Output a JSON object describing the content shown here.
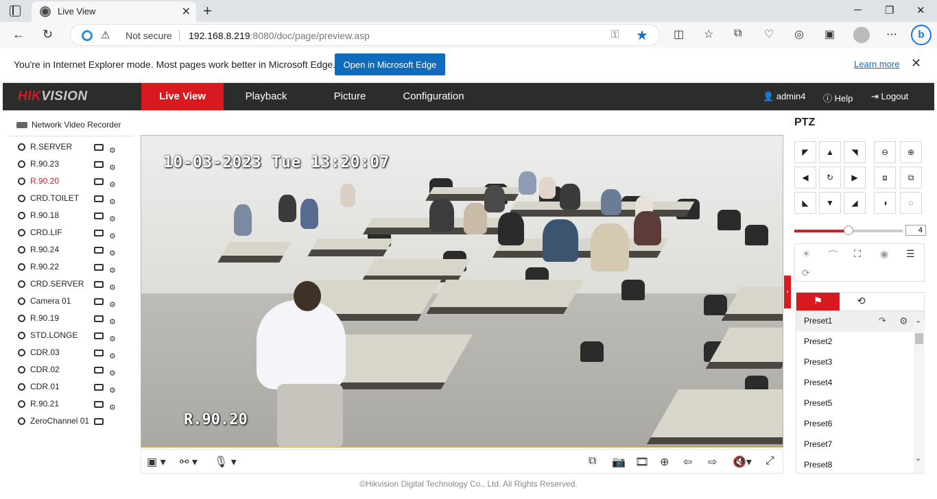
{
  "browser": {
    "tab_title": "Live View",
    "tab_close": "✕",
    "new_tab": "+",
    "not_secure": "Not secure",
    "url_host": "192.168.8.219",
    "url_path": ":8080/doc/page/preview.asp",
    "minimize": "─",
    "restore": "❐",
    "close": "✕"
  },
  "ie_banner": {
    "message": "You're in Internet Explorer mode. Most pages work better in Microsoft Edge.",
    "open_button": "Open in Microsoft Edge",
    "learn_more": "Learn more"
  },
  "header": {
    "logo_red": "HIK",
    "logo_gray": "VISION",
    "nav": [
      "Live View",
      "Playback",
      "Picture",
      "Configuration"
    ],
    "active_nav": "Live View",
    "user": "admin4",
    "help": "Help",
    "logout": "Logout"
  },
  "tree": {
    "root": "Network Video Recorder",
    "cameras": [
      "R.SERVER",
      "R.90.23",
      "R.90.20",
      "CRD.TOILET",
      "R.90.18",
      "CRD.LIF",
      "R.90.24",
      "R.90.22",
      "CRD.SERVER",
      "Camera 01",
      "R.90.19",
      "STD.LONGE",
      "CDR.03",
      "CDR.02",
      "CDR.01",
      "R.90.21",
      "ZeroChannel 01"
    ],
    "active_camera": "R.90.20"
  },
  "video": {
    "timestamp": "10-03-2023 Tue 13:20:07",
    "channel_name": "R.90.20"
  },
  "footer": "©Hikvision Digital Technology Co., Ltd. All Rights Reserved.",
  "ptz": {
    "title": "PTZ",
    "speed_value": "4",
    "speed_fraction": 0.5,
    "presets": [
      "Preset1",
      "Preset2",
      "Preset3",
      "Preset4",
      "Preset5",
      "Preset6",
      "Preset7",
      "Preset8"
    ],
    "selected_preset": "Preset1"
  },
  "colors": {
    "brand_red": "#d71920",
    "header_bg": "#2c2c2c",
    "edge_blue": "#0f6cbd"
  }
}
